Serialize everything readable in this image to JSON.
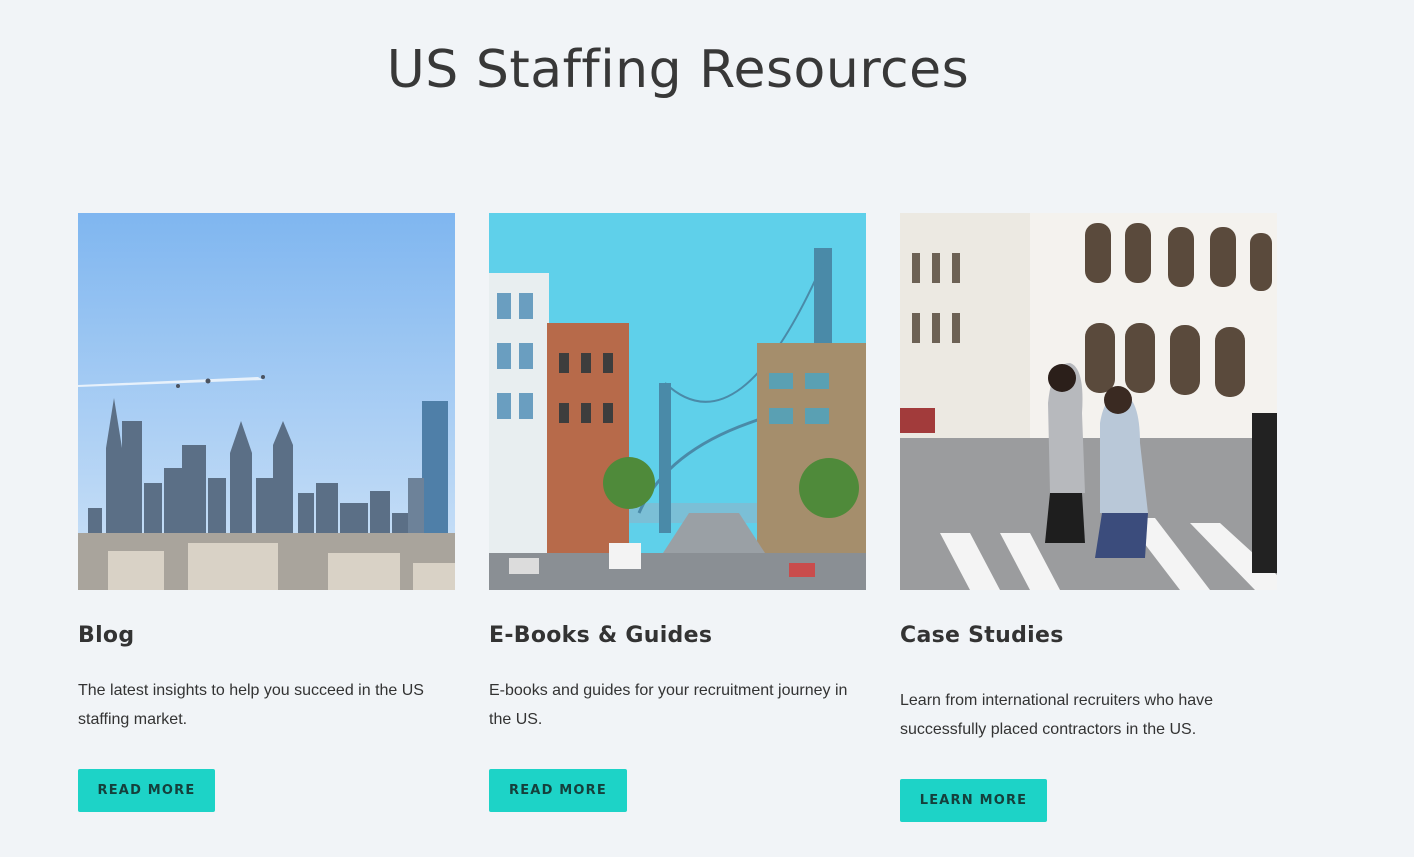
{
  "page": {
    "title": "US Staffing Resources"
  },
  "cards": [
    {
      "image": "philadelphia-skyline-photo",
      "title": "Blog",
      "description": "The latest insights to help you succeed in the US staffing market.",
      "button_label": "READ MORE"
    },
    {
      "image": "san-francisco-bay-bridge-street-photo",
      "title": "E-Books & Guides",
      "description": "E-books and guides for your recruitment journey in the US.",
      "button_label": "READ MORE"
    },
    {
      "image": "women-crossing-street-photo",
      "title": "Case Studies",
      "description": "Learn from international recruiters who have successfully placed contractors in the US.",
      "button_label": "LEARN MORE"
    }
  ],
  "colors": {
    "background": "#f1f4f7",
    "accent": "#1dd3c7",
    "text": "#333333"
  }
}
